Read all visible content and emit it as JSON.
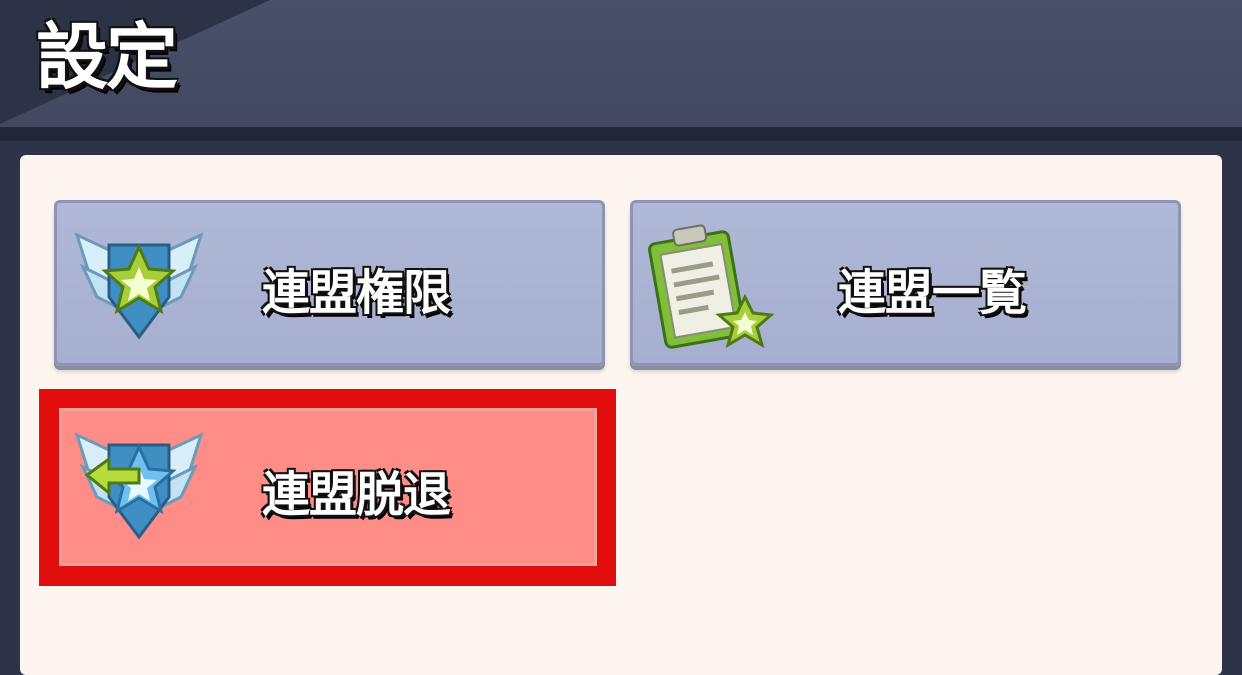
{
  "header": {
    "title": "設定"
  },
  "menu": {
    "items": [
      {
        "label": "連盟権限",
        "icon": "winged-star-shield-icon"
      },
      {
        "label": "連盟一覧",
        "icon": "clipboard-star-icon"
      },
      {
        "label": "連盟脱退",
        "icon": "winged-star-leave-icon"
      }
    ]
  },
  "colors": {
    "header": "#454c65",
    "panel": "#fdf5f0",
    "button": "#aab3d3",
    "highlight": "#e20d0d",
    "danger_button": "#ff8d87"
  }
}
